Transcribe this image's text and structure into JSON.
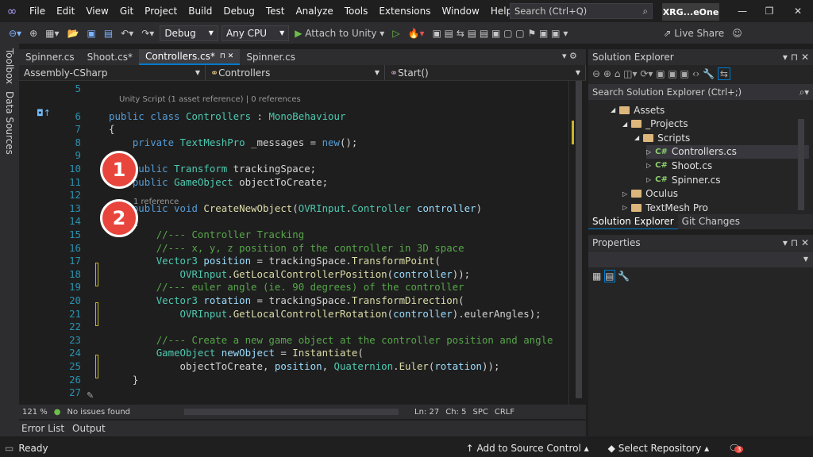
{
  "menu": [
    "File",
    "Edit",
    "View",
    "Git",
    "Project",
    "Build",
    "Debug",
    "Test",
    "Analyze",
    "Tools",
    "Extensions",
    "Window",
    "Help"
  ],
  "search": {
    "placeholder": "Search (Ctrl+Q)"
  },
  "solution_badge": "XRG...eOne",
  "toolbar": {
    "config": "Debug",
    "platform": "Any CPU",
    "attach": "Attach to Unity",
    "live_share": "Live Share"
  },
  "left_strip": {
    "toolbox": "Toolbox",
    "data_sources": "Data Sources"
  },
  "tabs": [
    {
      "label": "Spinner.cs",
      "active": false
    },
    {
      "label": "Shoot.cs*",
      "active": false
    },
    {
      "label": "Controllers.cs*",
      "active": true
    },
    {
      "label": "Spinner.cs",
      "active": false
    }
  ],
  "nav": {
    "project": "Assembly-CSharp",
    "class": "Controllers",
    "member": "Start()"
  },
  "lens": {
    "class": "Unity Script (1 asset reference) | 0 references",
    "method": "1 reference"
  },
  "badges": [
    "1",
    "2"
  ],
  "code_lines": [
    {
      "n": "5",
      "html": ""
    },
    {
      "n": "6",
      "html": "<span class='kw'>public class</span> <span class='ty'>Controllers</span> : <span class='ty'>MonoBehaviour</span>"
    },
    {
      "n": "7",
      "html": "{"
    },
    {
      "n": "8",
      "html": "    <span class='kw'>private</span> <span class='ty'>TextMeshPro</span> _messages = <span class='kw'>new</span>();"
    },
    {
      "n": "9",
      "html": ""
    },
    {
      "n": "10",
      "html": "    <span class='kw'>public</span> <span class='ty'>Transform</span> trackingSpace;"
    },
    {
      "n": "11",
      "html": "    <span class='kw'>public</span> <span class='ty'>GameObject</span> objectToCreate;"
    },
    {
      "n": "12",
      "html": ""
    },
    {
      "n": "13",
      "html": "    <span class='kw'>public void</span> <span class='fn'>CreateNewObject</span>(<span class='ty'>OVRInput</span>.<span class='ty'>Controller</span> <span class='pm'>controller</span>)"
    },
    {
      "n": "14",
      "html": "    {"
    },
    {
      "n": "15",
      "html": "        <span class='cm'>//--- Controller Tracking</span>"
    },
    {
      "n": "16",
      "html": "        <span class='cm'>//--- x, y, z position of the controller in 3D space</span>"
    },
    {
      "n": "17",
      "html": "        <span class='ty'>Vector3</span> <span class='pm'>position</span> = trackingSpace.<span class='fn'>TransformPoint</span>("
    },
    {
      "n": "18",
      "html": "            <span class='ty'>OVRInput</span>.<span class='fn'>GetLocalControllerPosition</span>(<span class='pm'>controller</span>));"
    },
    {
      "n": "19",
      "html": "        <span class='cm'>//--- euler angle (ie. 90 degrees) of the controller</span>"
    },
    {
      "n": "20",
      "html": "        <span class='ty'>Vector3</span> <span class='pm'>rotation</span> = trackingSpace.<span class='fn'>TransformDirection</span>("
    },
    {
      "n": "21",
      "html": "            <span class='ty'>OVRInput</span>.<span class='fn'>GetLocalControllerRotation</span>(<span class='pm'>controller</span>).eulerAngles);"
    },
    {
      "n": "22",
      "html": ""
    },
    {
      "n": "23",
      "html": "        <span class='cm'>//--- Create a new game object at the controller position and angle</span>"
    },
    {
      "n": "24",
      "html": "        <span class='ty'>GameObject</span> <span class='pm'>newObject</span> = <span class='fn'>Instantiate</span>("
    },
    {
      "n": "25",
      "html": "            objectToCreate, <span class='pm'>position</span>, <span class='ty'>Quaternion</span>.<span class='fn'>Euler</span>(<span class='pm'>rotation</span>));"
    },
    {
      "n": "26",
      "html": "    }"
    },
    {
      "n": "27",
      "html": ""
    }
  ],
  "editor_status": {
    "zoom": "121 %",
    "issues": "No issues found",
    "ln": "Ln: 27",
    "ch": "Ch: 5",
    "spc": "SPC",
    "crlf": "CRLF"
  },
  "bottom_tabs": [
    "Error List",
    "Output"
  ],
  "statusbar": {
    "ready": "Ready",
    "source_control": "Add to Source Control",
    "repo": "Select Repository",
    "notif_count": "3"
  },
  "solution_explorer": {
    "title": "Solution Explorer",
    "search": "Search Solution Explorer (Ctrl+;)",
    "items": [
      {
        "label": "Assets",
        "type": "folder",
        "indent": 0
      },
      {
        "label": "_Projects",
        "type": "folder",
        "indent": 1
      },
      {
        "label": "Scripts",
        "type": "folder",
        "indent": 2
      },
      {
        "label": "Controllers.cs",
        "type": "cs",
        "indent": 3
      },
      {
        "label": "Shoot.cs",
        "type": "cs",
        "indent": 3
      },
      {
        "label": "Spinner.cs",
        "type": "cs",
        "indent": 3
      },
      {
        "label": "Oculus",
        "type": "folder",
        "indent": 1
      },
      {
        "label": "TextMesh Pro",
        "type": "folder",
        "indent": 1
      }
    ],
    "tabs": [
      "Solution Explorer",
      "Git Changes"
    ]
  },
  "properties": {
    "title": "Properties"
  }
}
